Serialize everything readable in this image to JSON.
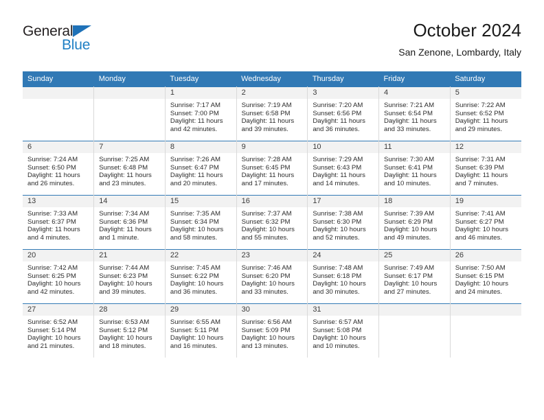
{
  "brand": {
    "name_top": "General",
    "name_bottom": "Blue",
    "triangle_color": "#1f72b8",
    "blue_color": "#1f7fc4"
  },
  "header": {
    "title": "October 2024",
    "subtitle": "San Zenone, Lombardy, Italy"
  },
  "theme": {
    "header_blue": "#3179b5",
    "daynum_band": "#f2f2f2",
    "grid_line": "#d9d9d9"
  },
  "weekday_headers": [
    "Sunday",
    "Monday",
    "Tuesday",
    "Wednesday",
    "Thursday",
    "Friday",
    "Saturday"
  ],
  "labels": {
    "sunrise": "Sunrise:",
    "sunset": "Sunset:",
    "daylight": "Daylight:"
  },
  "weeks": [
    [
      {
        "day": "",
        "sunrise": "",
        "sunset": "",
        "daylight_1": "",
        "daylight_2": ""
      },
      {
        "day": "",
        "sunrise": "",
        "sunset": "",
        "daylight_1": "",
        "daylight_2": ""
      },
      {
        "day": "1",
        "sunrise": "Sunrise: 7:17 AM",
        "sunset": "Sunset: 7:00 PM",
        "daylight_1": "Daylight: 11 hours",
        "daylight_2": "and 42 minutes."
      },
      {
        "day": "2",
        "sunrise": "Sunrise: 7:19 AM",
        "sunset": "Sunset: 6:58 PM",
        "daylight_1": "Daylight: 11 hours",
        "daylight_2": "and 39 minutes."
      },
      {
        "day": "3",
        "sunrise": "Sunrise: 7:20 AM",
        "sunset": "Sunset: 6:56 PM",
        "daylight_1": "Daylight: 11 hours",
        "daylight_2": "and 36 minutes."
      },
      {
        "day": "4",
        "sunrise": "Sunrise: 7:21 AM",
        "sunset": "Sunset: 6:54 PM",
        "daylight_1": "Daylight: 11 hours",
        "daylight_2": "and 33 minutes."
      },
      {
        "day": "5",
        "sunrise": "Sunrise: 7:22 AM",
        "sunset": "Sunset: 6:52 PM",
        "daylight_1": "Daylight: 11 hours",
        "daylight_2": "and 29 minutes."
      }
    ],
    [
      {
        "day": "6",
        "sunrise": "Sunrise: 7:24 AM",
        "sunset": "Sunset: 6:50 PM",
        "daylight_1": "Daylight: 11 hours",
        "daylight_2": "and 26 minutes."
      },
      {
        "day": "7",
        "sunrise": "Sunrise: 7:25 AM",
        "sunset": "Sunset: 6:48 PM",
        "daylight_1": "Daylight: 11 hours",
        "daylight_2": "and 23 minutes."
      },
      {
        "day": "8",
        "sunrise": "Sunrise: 7:26 AM",
        "sunset": "Sunset: 6:47 PM",
        "daylight_1": "Daylight: 11 hours",
        "daylight_2": "and 20 minutes."
      },
      {
        "day": "9",
        "sunrise": "Sunrise: 7:28 AM",
        "sunset": "Sunset: 6:45 PM",
        "daylight_1": "Daylight: 11 hours",
        "daylight_2": "and 17 minutes."
      },
      {
        "day": "10",
        "sunrise": "Sunrise: 7:29 AM",
        "sunset": "Sunset: 6:43 PM",
        "daylight_1": "Daylight: 11 hours",
        "daylight_2": "and 14 minutes."
      },
      {
        "day": "11",
        "sunrise": "Sunrise: 7:30 AM",
        "sunset": "Sunset: 6:41 PM",
        "daylight_1": "Daylight: 11 hours",
        "daylight_2": "and 10 minutes."
      },
      {
        "day": "12",
        "sunrise": "Sunrise: 7:31 AM",
        "sunset": "Sunset: 6:39 PM",
        "daylight_1": "Daylight: 11 hours",
        "daylight_2": "and 7 minutes."
      }
    ],
    [
      {
        "day": "13",
        "sunrise": "Sunrise: 7:33 AM",
        "sunset": "Sunset: 6:37 PM",
        "daylight_1": "Daylight: 11 hours",
        "daylight_2": "and 4 minutes."
      },
      {
        "day": "14",
        "sunrise": "Sunrise: 7:34 AM",
        "sunset": "Sunset: 6:36 PM",
        "daylight_1": "Daylight: 11 hours",
        "daylight_2": "and 1 minute."
      },
      {
        "day": "15",
        "sunrise": "Sunrise: 7:35 AM",
        "sunset": "Sunset: 6:34 PM",
        "daylight_1": "Daylight: 10 hours",
        "daylight_2": "and 58 minutes."
      },
      {
        "day": "16",
        "sunrise": "Sunrise: 7:37 AM",
        "sunset": "Sunset: 6:32 PM",
        "daylight_1": "Daylight: 10 hours",
        "daylight_2": "and 55 minutes."
      },
      {
        "day": "17",
        "sunrise": "Sunrise: 7:38 AM",
        "sunset": "Sunset: 6:30 PM",
        "daylight_1": "Daylight: 10 hours",
        "daylight_2": "and 52 minutes."
      },
      {
        "day": "18",
        "sunrise": "Sunrise: 7:39 AM",
        "sunset": "Sunset: 6:29 PM",
        "daylight_1": "Daylight: 10 hours",
        "daylight_2": "and 49 minutes."
      },
      {
        "day": "19",
        "sunrise": "Sunrise: 7:41 AM",
        "sunset": "Sunset: 6:27 PM",
        "daylight_1": "Daylight: 10 hours",
        "daylight_2": "and 46 minutes."
      }
    ],
    [
      {
        "day": "20",
        "sunrise": "Sunrise: 7:42 AM",
        "sunset": "Sunset: 6:25 PM",
        "daylight_1": "Daylight: 10 hours",
        "daylight_2": "and 42 minutes."
      },
      {
        "day": "21",
        "sunrise": "Sunrise: 7:44 AM",
        "sunset": "Sunset: 6:23 PM",
        "daylight_1": "Daylight: 10 hours",
        "daylight_2": "and 39 minutes."
      },
      {
        "day": "22",
        "sunrise": "Sunrise: 7:45 AM",
        "sunset": "Sunset: 6:22 PM",
        "daylight_1": "Daylight: 10 hours",
        "daylight_2": "and 36 minutes."
      },
      {
        "day": "23",
        "sunrise": "Sunrise: 7:46 AM",
        "sunset": "Sunset: 6:20 PM",
        "daylight_1": "Daylight: 10 hours",
        "daylight_2": "and 33 minutes."
      },
      {
        "day": "24",
        "sunrise": "Sunrise: 7:48 AM",
        "sunset": "Sunset: 6:18 PM",
        "daylight_1": "Daylight: 10 hours",
        "daylight_2": "and 30 minutes."
      },
      {
        "day": "25",
        "sunrise": "Sunrise: 7:49 AM",
        "sunset": "Sunset: 6:17 PM",
        "daylight_1": "Daylight: 10 hours",
        "daylight_2": "and 27 minutes."
      },
      {
        "day": "26",
        "sunrise": "Sunrise: 7:50 AM",
        "sunset": "Sunset: 6:15 PM",
        "daylight_1": "Daylight: 10 hours",
        "daylight_2": "and 24 minutes."
      }
    ],
    [
      {
        "day": "27",
        "sunrise": "Sunrise: 6:52 AM",
        "sunset": "Sunset: 5:14 PM",
        "daylight_1": "Daylight: 10 hours",
        "daylight_2": "and 21 minutes."
      },
      {
        "day": "28",
        "sunrise": "Sunrise: 6:53 AM",
        "sunset": "Sunset: 5:12 PM",
        "daylight_1": "Daylight: 10 hours",
        "daylight_2": "and 18 minutes."
      },
      {
        "day": "29",
        "sunrise": "Sunrise: 6:55 AM",
        "sunset": "Sunset: 5:11 PM",
        "daylight_1": "Daylight: 10 hours",
        "daylight_2": "and 16 minutes."
      },
      {
        "day": "30",
        "sunrise": "Sunrise: 6:56 AM",
        "sunset": "Sunset: 5:09 PM",
        "daylight_1": "Daylight: 10 hours",
        "daylight_2": "and 13 minutes."
      },
      {
        "day": "31",
        "sunrise": "Sunrise: 6:57 AM",
        "sunset": "Sunset: 5:08 PM",
        "daylight_1": "Daylight: 10 hours",
        "daylight_2": "and 10 minutes."
      },
      {
        "day": "",
        "sunrise": "",
        "sunset": "",
        "daylight_1": "",
        "daylight_2": ""
      },
      {
        "day": "",
        "sunrise": "",
        "sunset": "",
        "daylight_1": "",
        "daylight_2": ""
      }
    ]
  ]
}
